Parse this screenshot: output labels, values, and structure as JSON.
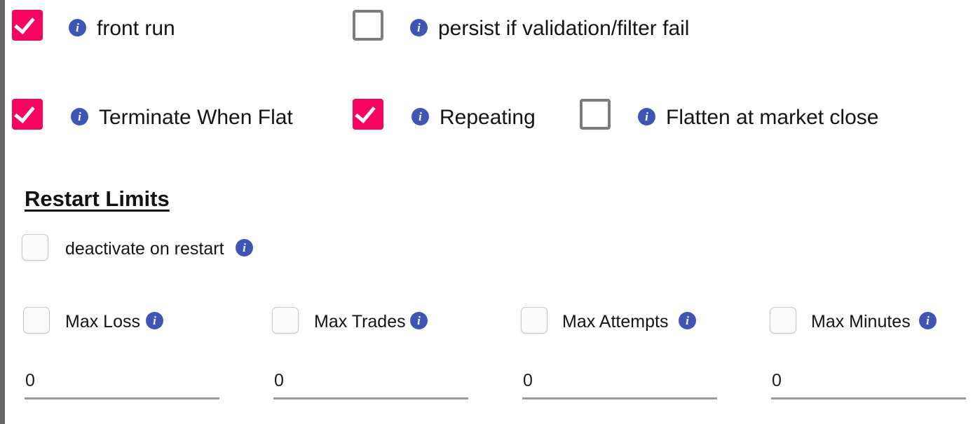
{
  "theme": {
    "checkbox_checked_color": "#f5055f",
    "checkbox_outline_color": "#7c7c7c",
    "checkbox_soft_border_color": "#c9c9c9",
    "info_icon_color": "#3f55b5",
    "left_border_color": "#666666",
    "text_color": "#141414",
    "field_underline_color": "#9a9a9a",
    "background": "#ffffff"
  },
  "icons": {
    "info": "i",
    "check": "check-mark"
  },
  "options_rows": [
    {
      "row_id": "row-1",
      "items": [
        {
          "id": "front-run",
          "label": "front run",
          "checked": true,
          "info": true
        },
        {
          "id": "persist-if-validation-filter-fail",
          "label": "persist if validation/filter fail",
          "checked": false,
          "info": true
        }
      ]
    },
    {
      "row_id": "row-2",
      "items": [
        {
          "id": "terminate-when-flat",
          "label": "Terminate When Flat",
          "checked": true,
          "info": true
        },
        {
          "id": "repeating",
          "label": "Repeating",
          "checked": true,
          "info": true
        },
        {
          "id": "flatten-at-market-close",
          "label": "Flatten at market close",
          "checked": false,
          "info": true
        }
      ]
    }
  ],
  "restart_limits": {
    "heading": "Restart Limits",
    "deactivate": {
      "id": "deactivate-on-restart",
      "label": "deactivate on restart",
      "checked": false,
      "info": true
    },
    "limits": [
      {
        "id": "max-loss",
        "label": "Max Loss",
        "checked": false,
        "info": true,
        "value": "0"
      },
      {
        "id": "max-trades",
        "label": "Max Trades",
        "checked": false,
        "info": true,
        "value": "0"
      },
      {
        "id": "max-attempts",
        "label": "Max Attempts",
        "checked": false,
        "info": true,
        "value": "0"
      },
      {
        "id": "max-minutes",
        "label": "Max Minutes",
        "checked": false,
        "info": true,
        "value": "0"
      }
    ]
  }
}
